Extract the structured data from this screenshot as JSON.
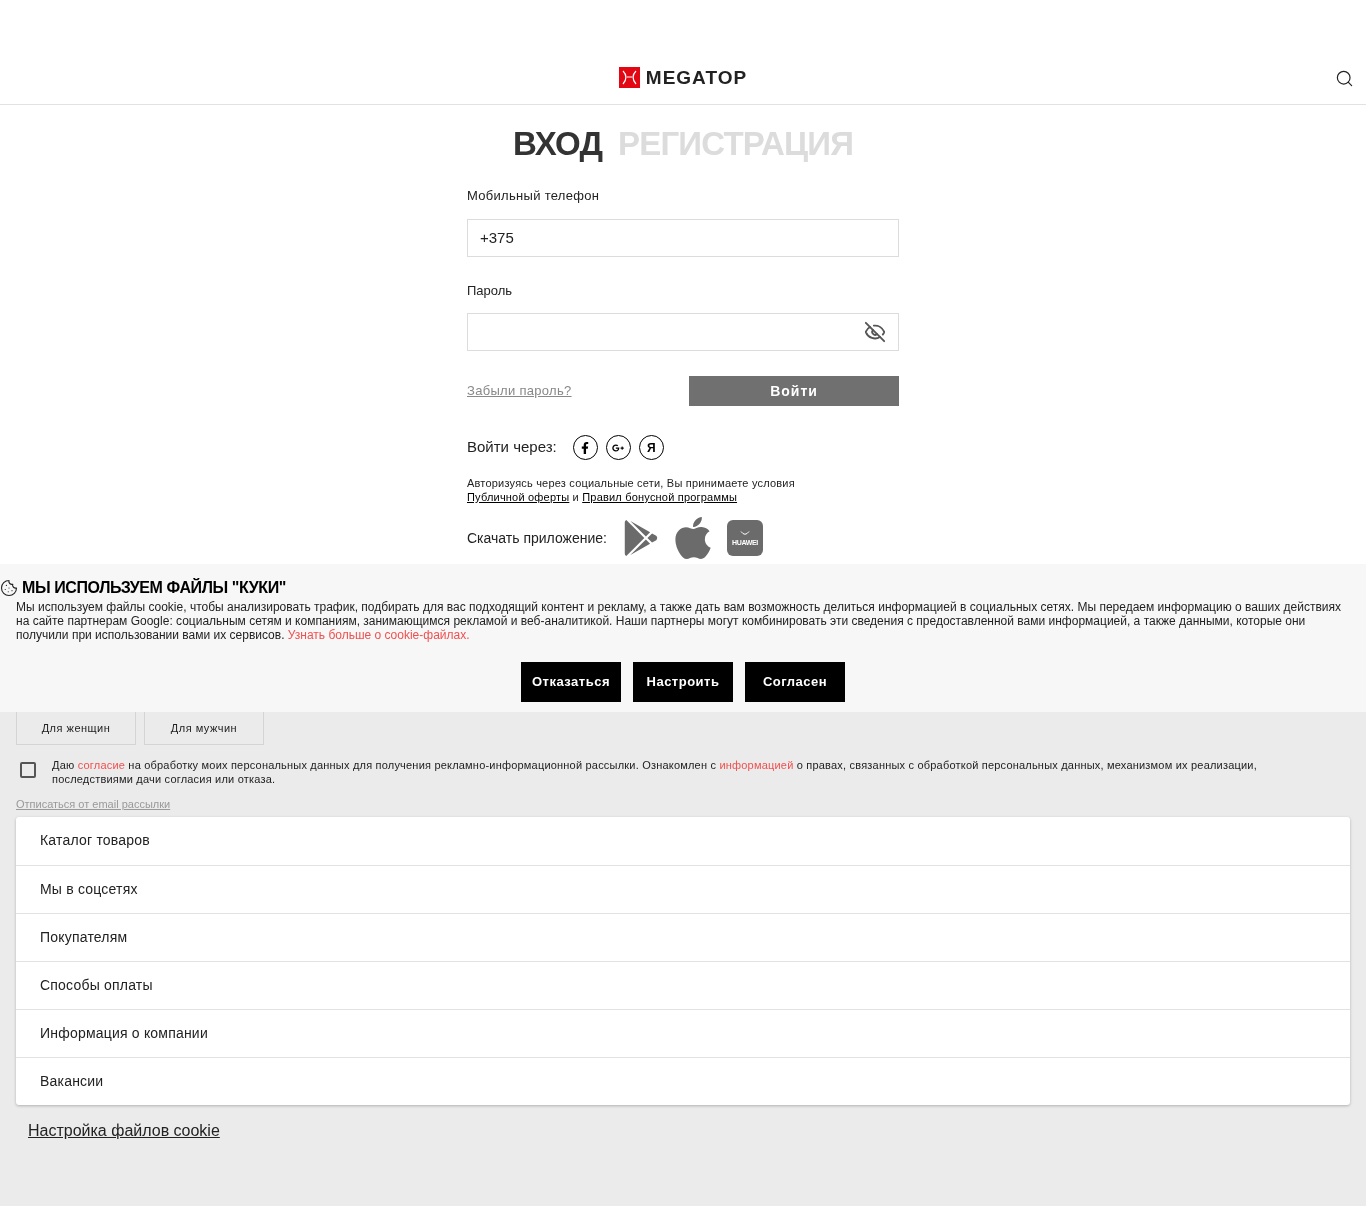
{
  "header": {
    "logo_text": "MEGATOP"
  },
  "tabs": [
    {
      "label": "ВХОД",
      "selected": true
    },
    {
      "label": "РЕГИСТРАЦИЯ",
      "selected": false
    }
  ],
  "form": {
    "phone_label": "Мобильный телефон",
    "phone_value": "+375",
    "password_label": "Пароль",
    "forgot_link": "Забыли пароль?",
    "submit": "Войти",
    "social_label": "Войти через:",
    "social": [
      {
        "kind": "facebook"
      },
      {
        "kind": "google"
      },
      {
        "kind": "yandex",
        "text": "Я"
      }
    ],
    "terms": [
      {
        "kind": "text",
        "text": "Авторизуясь через социальные сети, Вы принимаете условия "
      },
      {
        "kind": "link",
        "text": "Публичной оферты"
      },
      {
        "kind": "text",
        "text": " и "
      },
      {
        "kind": "link",
        "text": "Правил бонусной программы"
      }
    ],
    "app_label": "Скачать приложение:",
    "apps": [
      {
        "kind": "google_play"
      },
      {
        "kind": "apple"
      },
      {
        "kind": "huawei",
        "text": "HUAWEI"
      }
    ]
  },
  "cookie_banner": {
    "title": "МЫ ИСПОЛЬЗУЕМ ФАЙЛЫ \"КУКИ\"",
    "text": [
      {
        "kind": "text",
        "text": "Мы используем файлы cookie, чтобы анализировать трафик, подбирать для вас подходящий контент и рекламу, а также дать вам возможность делиться информацией в социальных сетях. Мы передаем информацию о ваших действиях на сайте партнерам Google: социальным сетям и компаниям, занимающимся рекламой и веб-аналитикой. Наши партнеры могут комбинировать эти сведения с предоставленной вами информацией, а также данными, которые они получили при использовании вами их сервисов. "
      },
      {
        "kind": "link",
        "text": "Узнать больше о cookie-файлах."
      }
    ],
    "buttons": [
      "Отказаться",
      "Настроить",
      "Согласен"
    ]
  },
  "subscribe": {
    "audience_buttons": [
      "Для женщин",
      "Для мужчин"
    ],
    "consent_checked": false,
    "consent": [
      {
        "kind": "text",
        "text": "Даю "
      },
      {
        "kind": "link",
        "text": "согласие"
      },
      {
        "kind": "text",
        "text": " на обработку моих персональных данных для получения рекламно-информационной рассылки. Ознакомлен с "
      },
      {
        "kind": "link",
        "text": "информацией"
      },
      {
        "kind": "text",
        "text": " о правах, связанных с обработкой персональных данных, механизмом их реализации, последствиями дачи согласия или отказа."
      }
    ],
    "unsubscribe_link": "Отписаться от email рассылки"
  },
  "footer_menu": [
    {
      "label": "Каталог товаров"
    },
    {
      "label": "Мы в соцсетях"
    },
    {
      "label": "Покупателям"
    },
    {
      "label": "Способы оплаты"
    },
    {
      "label": "Информация о компании"
    },
    {
      "label": "Вакансии"
    }
  ],
  "cookie_settings_link": "Настройка файлов cookie"
}
